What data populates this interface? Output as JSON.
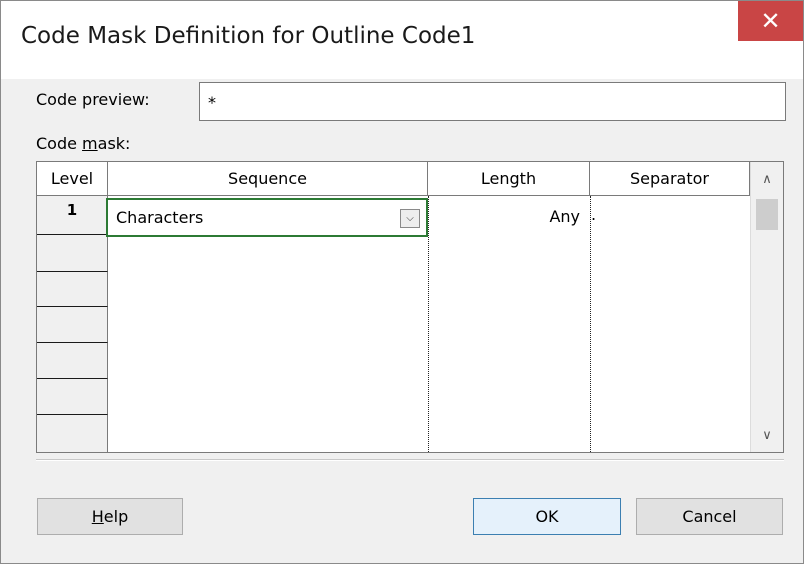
{
  "window": {
    "title": "Code Mask Definition for Outline Code1",
    "close_glyph": "✕"
  },
  "code_preview": {
    "label": "Code preview:",
    "value": "*"
  },
  "code_mask": {
    "label_prefix": "Code ",
    "label_accel": "m",
    "label_suffix": "ask:"
  },
  "grid": {
    "columns": [
      "Level",
      "Sequence",
      "Length",
      "Separator"
    ],
    "rows": [
      {
        "level": "1",
        "sequence": "Characters",
        "length": "Any",
        "separator": "."
      },
      {
        "level": "",
        "sequence": "",
        "length": "",
        "separator": ""
      },
      {
        "level": "",
        "sequence": "",
        "length": "",
        "separator": ""
      },
      {
        "level": "",
        "sequence": "",
        "length": "",
        "separator": ""
      },
      {
        "level": "",
        "sequence": "",
        "length": "",
        "separator": ""
      },
      {
        "level": "",
        "sequence": "",
        "length": "",
        "separator": ""
      },
      {
        "level": "",
        "sequence": "",
        "length": "",
        "separator": ""
      }
    ]
  },
  "buttons": {
    "help_accel": "H",
    "help_rest": "elp",
    "ok": "OK",
    "cancel": "Cancel"
  },
  "colors": {
    "close_bg": "#c94545",
    "active_cell_border": "#2c7a34",
    "default_button_border": "#3c7fb1"
  }
}
